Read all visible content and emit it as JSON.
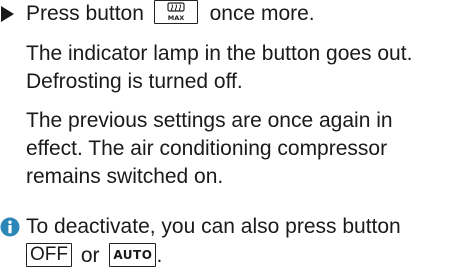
{
  "step": {
    "before": "Press button",
    "after": "once more."
  },
  "defrost_key": {
    "label": "MAX",
    "icon": "rear-defrost-icon"
  },
  "result_1": {
    "line1": "The indicator lamp in the button goes out.",
    "line2": "Defrosting is turned off."
  },
  "result_2": {
    "line1": "The previous settings are once again in",
    "line2": "effect. The air conditioning compressor",
    "line3": "remains switched on."
  },
  "note": {
    "icon": "info-icon",
    "line1": "To deactivate, you can also press button",
    "key_off": "OFF",
    "or_text": "or",
    "key_auto": "AUTO",
    "end": "."
  },
  "colors": {
    "text": "#1a1a1a",
    "info_icon": "#2a87b8"
  }
}
